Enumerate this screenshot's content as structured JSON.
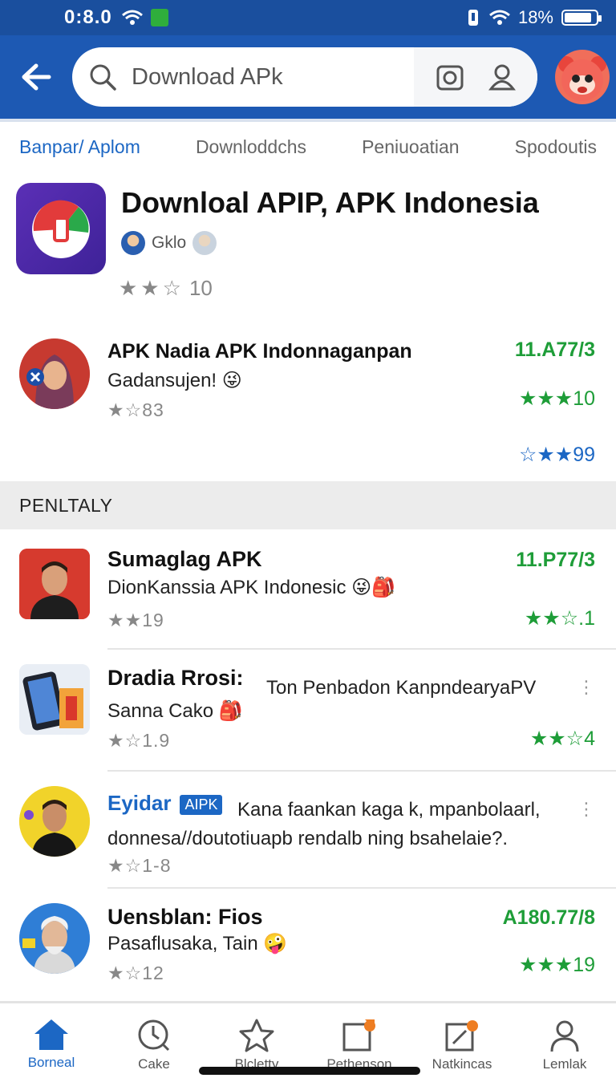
{
  "status_bar": {
    "time": "0:8.0",
    "battery": "18%"
  },
  "search": {
    "query": "Download APk",
    "icons": [
      "search-icon",
      "camera-icon",
      "profile-icon"
    ]
  },
  "tabs": [
    "Banpar/ Aplom",
    "Downloddchs",
    "Peniuoatian",
    "Spodoutis"
  ],
  "hero": {
    "title": "Downloal APIP, APK Indonesia",
    "developer": "Gklo",
    "rating_value": "10",
    "stars": "★★☆"
  },
  "featured": {
    "title": "APK Nadia APK Indonnaganpan",
    "subtitle": "Gadansujen! 😜",
    "stars": "★☆",
    "rating": "83",
    "right_value": "11.A77/3",
    "right_stars": "★★★",
    "right_rating": "10",
    "right_stars_blue": "☆★★",
    "right_rating_blue": "99"
  },
  "section_label": "PENLTALY",
  "list": [
    {
      "title": "Sumaglag APK",
      "subtitle": "DionKanssia APK Indonesic 😜🎒",
      "stars": "★★",
      "rating": "19",
      "right_value": "11.P77/3",
      "right_stars": "★★☆",
      "right_rating": ".1"
    },
    {
      "title": "Dradia Rrosi:",
      "extra": "Ton Penbadon KanpndearyaPV",
      "subtitle": "Sanna Cako 🎒",
      "stars": "★☆",
      "rating": "1.9",
      "right_stars": "★★☆",
      "right_rating": "4"
    },
    {
      "title": "Eyidar",
      "badge": "AIPK",
      "extra": "Kana faankan kaga k, mpanbolaarl,",
      "subtitle": "donnesa//doutotiuapb rendalb ning bsahelaie?.",
      "stars": "★☆",
      "rating": "1-8"
    },
    {
      "title": "Uensblan: Fios",
      "subtitle": "Pasaflusaka, Tain 🤪",
      "stars": "★☆",
      "rating": "12",
      "right_value": "A180.77/8",
      "right_stars": "★★★",
      "right_rating": "19"
    }
  ],
  "bottom_nav": [
    {
      "label": "Borneal",
      "icon": "home-icon"
    },
    {
      "label": "Cake",
      "icon": "clock-icon"
    },
    {
      "label": "Blcletty",
      "icon": "star-icon"
    },
    {
      "label": "Pethenson",
      "icon": "notification-icon"
    },
    {
      "label": "Natkincas",
      "icon": "app-icon"
    },
    {
      "label": "Lemlak",
      "icon": "profile-icon"
    }
  ],
  "colors": {
    "primary": "#1d59b3",
    "accent_green": "#1e9d38",
    "tab_active": "#1c67c4"
  }
}
